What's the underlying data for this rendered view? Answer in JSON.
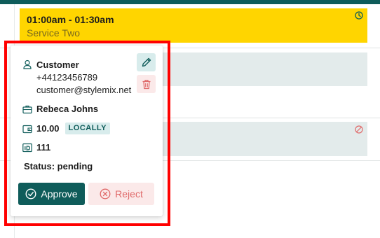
{
  "calendar": {
    "event": {
      "time": "01:00am - 01:30am",
      "service": "Service Two"
    }
  },
  "popup": {
    "customer_label": "Customer",
    "phone": "+44123456789",
    "email": "customer@stylemix.net",
    "employee": "Rebeca Johns",
    "price": "10.00",
    "location_badge": "LOCALLY",
    "id_value": "111",
    "status": "Status: pending",
    "approve_label": "Approve",
    "reject_label": "Reject"
  },
  "colors": {
    "brand": "#0f5c5a",
    "event_yellow": "#ffd500",
    "danger": "#e06a6a",
    "frame": "#ff0000"
  },
  "icons": [
    "user-icon",
    "briefcase-icon",
    "wallet-icon",
    "id-card-icon",
    "pencil-icon",
    "trash-icon",
    "check-circle-icon",
    "x-circle-icon",
    "clock-icon",
    "ban-icon"
  ]
}
